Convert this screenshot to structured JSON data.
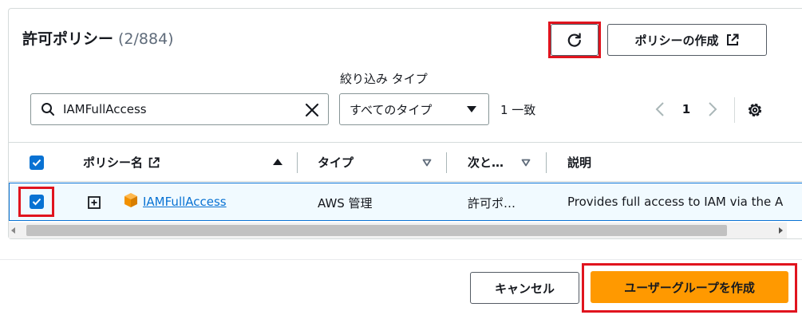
{
  "panel": {
    "title": "許可ポリシー",
    "count": "(2/884)",
    "create_policy_label": "ポリシーの作成"
  },
  "filter": {
    "type_label": "絞り込み タイプ",
    "search_value": "IAMFullAccess",
    "type_select_value": "すべてのタイプ",
    "match_count": "1 一致"
  },
  "pagination": {
    "current_page": "1"
  },
  "table": {
    "columns": [
      "ポリシー名",
      "タイプ",
      "次と…",
      "説明"
    ],
    "rows": [
      {
        "selected": true,
        "policy_name": "IAMFullAccess",
        "type": "AWS 管理",
        "attached_as": "許可ポ…",
        "description": "Provides full access to IAM via the A"
      }
    ]
  },
  "footer": {
    "cancel_label": "キャンセル",
    "create_group_label": "ユーザーグループを作成"
  },
  "colors": {
    "accent": "#0972d3",
    "primary_button": "#ff9900",
    "highlight_box": "#e0141e",
    "selected_row_bg": "#f1faff"
  },
  "icons": [
    "refresh-icon",
    "external-link-icon",
    "search-icon",
    "clear-icon",
    "caret-down-icon",
    "chevron-left-icon",
    "chevron-right-icon",
    "settings-icon",
    "check-icon",
    "sort-ascending-icon",
    "sort-icon",
    "expand-icon",
    "aws-managed-policy-icon"
  ]
}
